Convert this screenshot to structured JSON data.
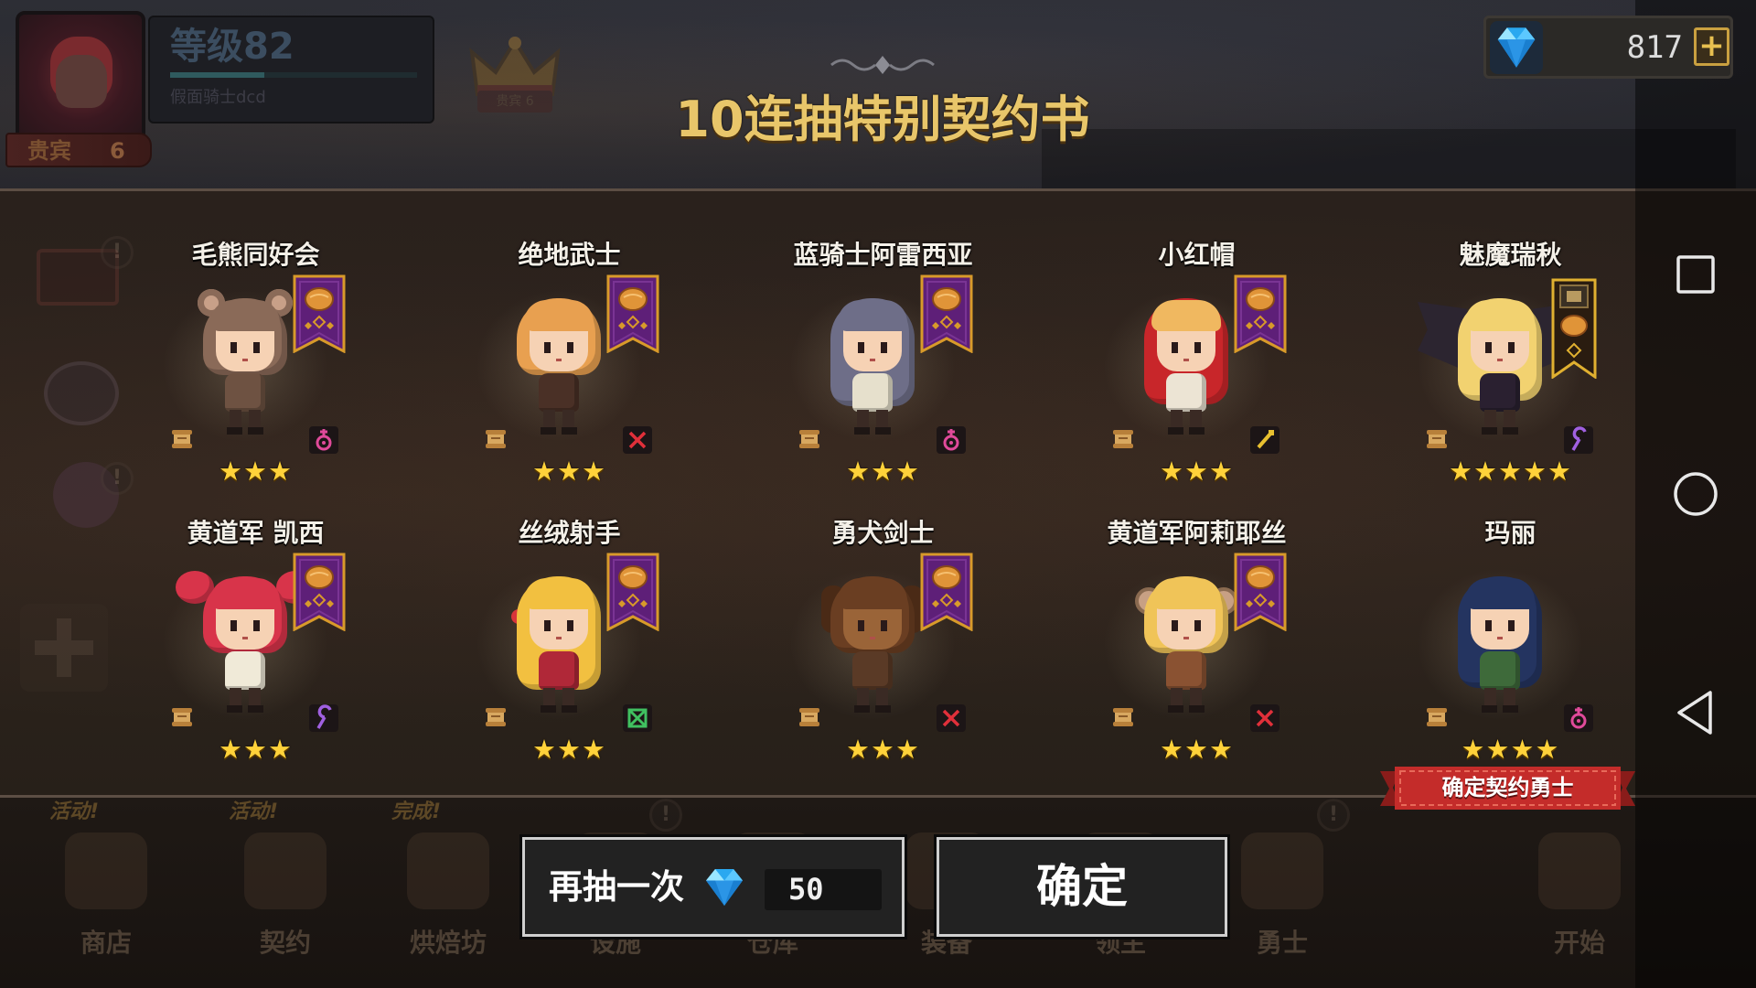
{
  "player": {
    "level_label": "等级82",
    "level_progress": 0.38,
    "name": "假面骑士dcd",
    "vip_label": "贵宾",
    "vip_level": "6",
    "crown_label": "贵宾 6"
  },
  "currency": {
    "gems": "817",
    "add_label": "+",
    "gem_icon": "gem-icon"
  },
  "title": "10连抽特别契约书",
  "colors": {
    "title": "#e8c66a",
    "stars": "#ffd23a",
    "ribbon": "#c42c2a"
  },
  "heroes": [
    {
      "name": "毛熊同好会",
      "stars": 3,
      "class_icon": "healer-icon",
      "class_color": "#e04a9a",
      "banner_icon": "bread-banner-icon",
      "hair": "#8a6a58",
      "outfit": "#6e5242"
    },
    {
      "name": "绝地武士",
      "stars": 3,
      "class_icon": "sword-icon",
      "class_color": "#e0303a",
      "banner_icon": "bread-banner-icon",
      "hair": "#e8a050",
      "outfit": "#4a3026"
    },
    {
      "name": "蓝骑士阿雷西亚",
      "stars": 3,
      "class_icon": "healer-icon",
      "class_color": "#e04a9a",
      "banner_icon": "bread-banner-icon",
      "hair": "#6e6e88",
      "outfit": "#e6e0cc"
    },
    {
      "name": "小红帽",
      "stars": 3,
      "class_icon": "gun-icon",
      "class_color": "#e8c030",
      "banner_icon": "bread-banner-icon",
      "hair": "#c8262a",
      "outfit": "#ece4d4"
    },
    {
      "name": "魅魔瑞秋",
      "stars": 5,
      "class_icon": "staff-icon",
      "class_color": "#a060e0",
      "banner_icon": "gold-bread-banner-icon",
      "hair": "#f2d270",
      "outfit": "#2a2030"
    },
    {
      "name": "黄道军 凯西",
      "stars": 3,
      "class_icon": "staff-icon",
      "class_color": "#a060e0",
      "banner_icon": "bread-banner-icon",
      "hair": "#d8344a",
      "outfit": "#f0ead8"
    },
    {
      "name": "丝绒射手",
      "stars": 3,
      "class_icon": "bow-icon",
      "class_color": "#40c060",
      "banner_icon": "bread-banner-icon",
      "hair": "#f2c040",
      "outfit": "#b02838"
    },
    {
      "name": "勇犬剑士",
      "stars": 3,
      "class_icon": "sword-icon",
      "class_color": "#e0303a",
      "banner_icon": "bread-banner-icon",
      "hair": "#6a3e22",
      "outfit": "#5a3a26"
    },
    {
      "name": "黄道军阿莉耶丝",
      "stars": 3,
      "class_icon": "sword-icon",
      "class_color": "#e0303a",
      "banner_icon": "bread-banner-icon",
      "hair": "#f0c458",
      "outfit": "#8a5232"
    },
    {
      "name": "玛丽",
      "stars": 4,
      "class_icon": "healer-icon",
      "class_color": "#e04a9a",
      "banner_icon": "",
      "hair": "#243460",
      "outfit": "#3e6a3a"
    }
  ],
  "confirm_ribbon": "确定契约勇士",
  "redraw": {
    "label": "再抽一次",
    "cost": "50"
  },
  "confirm": {
    "label": "确定"
  },
  "bottom_nav": [
    {
      "label": "商店",
      "badge": "活动!"
    },
    {
      "label": "契约",
      "badge": "活动!"
    },
    {
      "label": "烘焙坊",
      "badge": "完成!"
    },
    {
      "label": "设施"
    },
    {
      "label": "仓库"
    },
    {
      "label": "装备"
    },
    {
      "label": "领主"
    },
    {
      "label": "勇士"
    },
    {
      "label": "开始"
    }
  ],
  "system_nav": {
    "recent": "recent-apps-icon",
    "home": "home-icon",
    "back": "back-icon"
  }
}
